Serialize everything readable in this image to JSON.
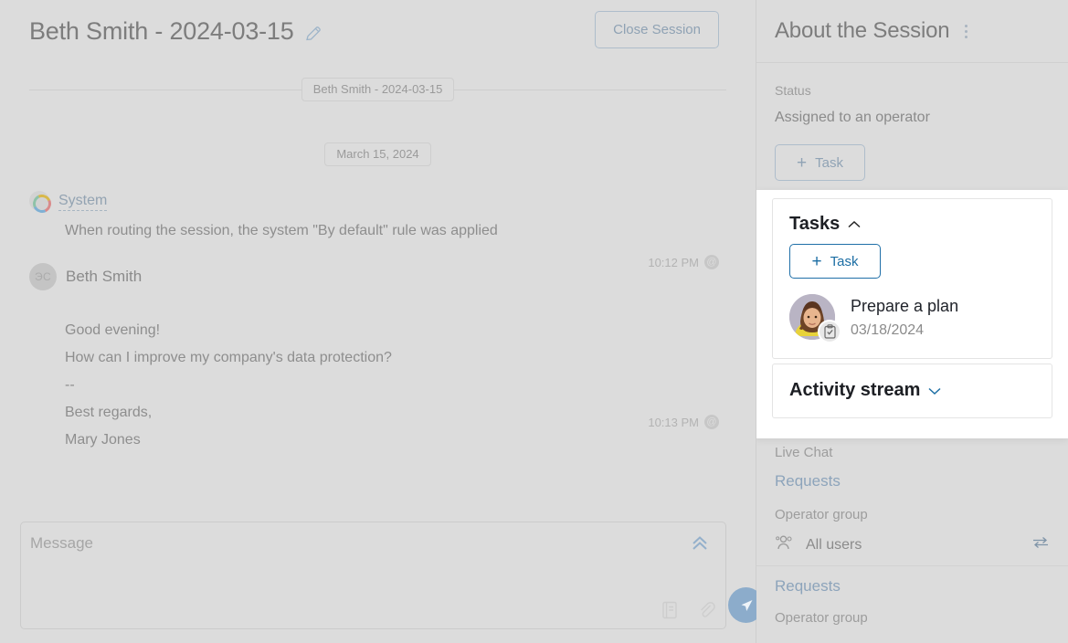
{
  "chat": {
    "title": "Beth Smith - 2024-03-15",
    "edit_icon": "pencil-icon",
    "close_session_label": "Close Session",
    "session_chip": "Beth Smith - 2024-03-15",
    "date_chip": "March 15, 2024",
    "messages": [
      {
        "author": "System",
        "author_type": "system",
        "text": "When routing the session, the system \"By default\" rule was applied",
        "time": "10:12 PM"
      },
      {
        "author": "Beth Smith",
        "author_type": "user",
        "avatar_initials": "ЭС",
        "lines": [
          "Good evening!",
          "How can I improve my company's data protection?",
          "--",
          "Best regards,",
          "Mary Jones"
        ],
        "time": "10:13 PM"
      }
    ],
    "composer": {
      "placeholder": "Message",
      "expand_icon": "chevron-double-up-icon",
      "template_icon": "quick-reply-icon",
      "attach_icon": "paperclip-icon",
      "send_icon": "send-icon"
    }
  },
  "sidebar": {
    "title": "About the Session",
    "menu_icon": "kebab-menu-icon",
    "status_label": "Status",
    "status_value": "Assigned to an operator",
    "add_task_label": "Task",
    "add_task_icon": "plus-icon",
    "channel_label": "Live Chat",
    "channel_link": "Requests",
    "operator_group_label": "Operator group",
    "operator_group_value": "All users",
    "operator_group_icon": "users-icon",
    "transfer_icon": "transfer-icon",
    "requests_link": "Requests",
    "operator_group_label2": "Operator group"
  },
  "overlay": {
    "tasks": {
      "heading": "Tasks",
      "collapse_icon": "chevron-up-icon",
      "add_task_label": "Task",
      "add_task_icon": "plus-icon",
      "items": [
        {
          "title": "Prepare a plan",
          "date": "03/18/2024",
          "badge_icon": "clipboard-check-icon",
          "avatar": "user-photo"
        }
      ]
    },
    "activity": {
      "heading": "Activity stream",
      "expand_icon": "chevron-down-icon"
    }
  },
  "colors": {
    "page_bg": "#dcdcdc",
    "muted_text": "#8e8e8e",
    "link_blue": "#8da4bb",
    "accent_blue": "#1c6ea4",
    "send_blue": "#8caccb",
    "overlay_bg": "#ffffff"
  }
}
